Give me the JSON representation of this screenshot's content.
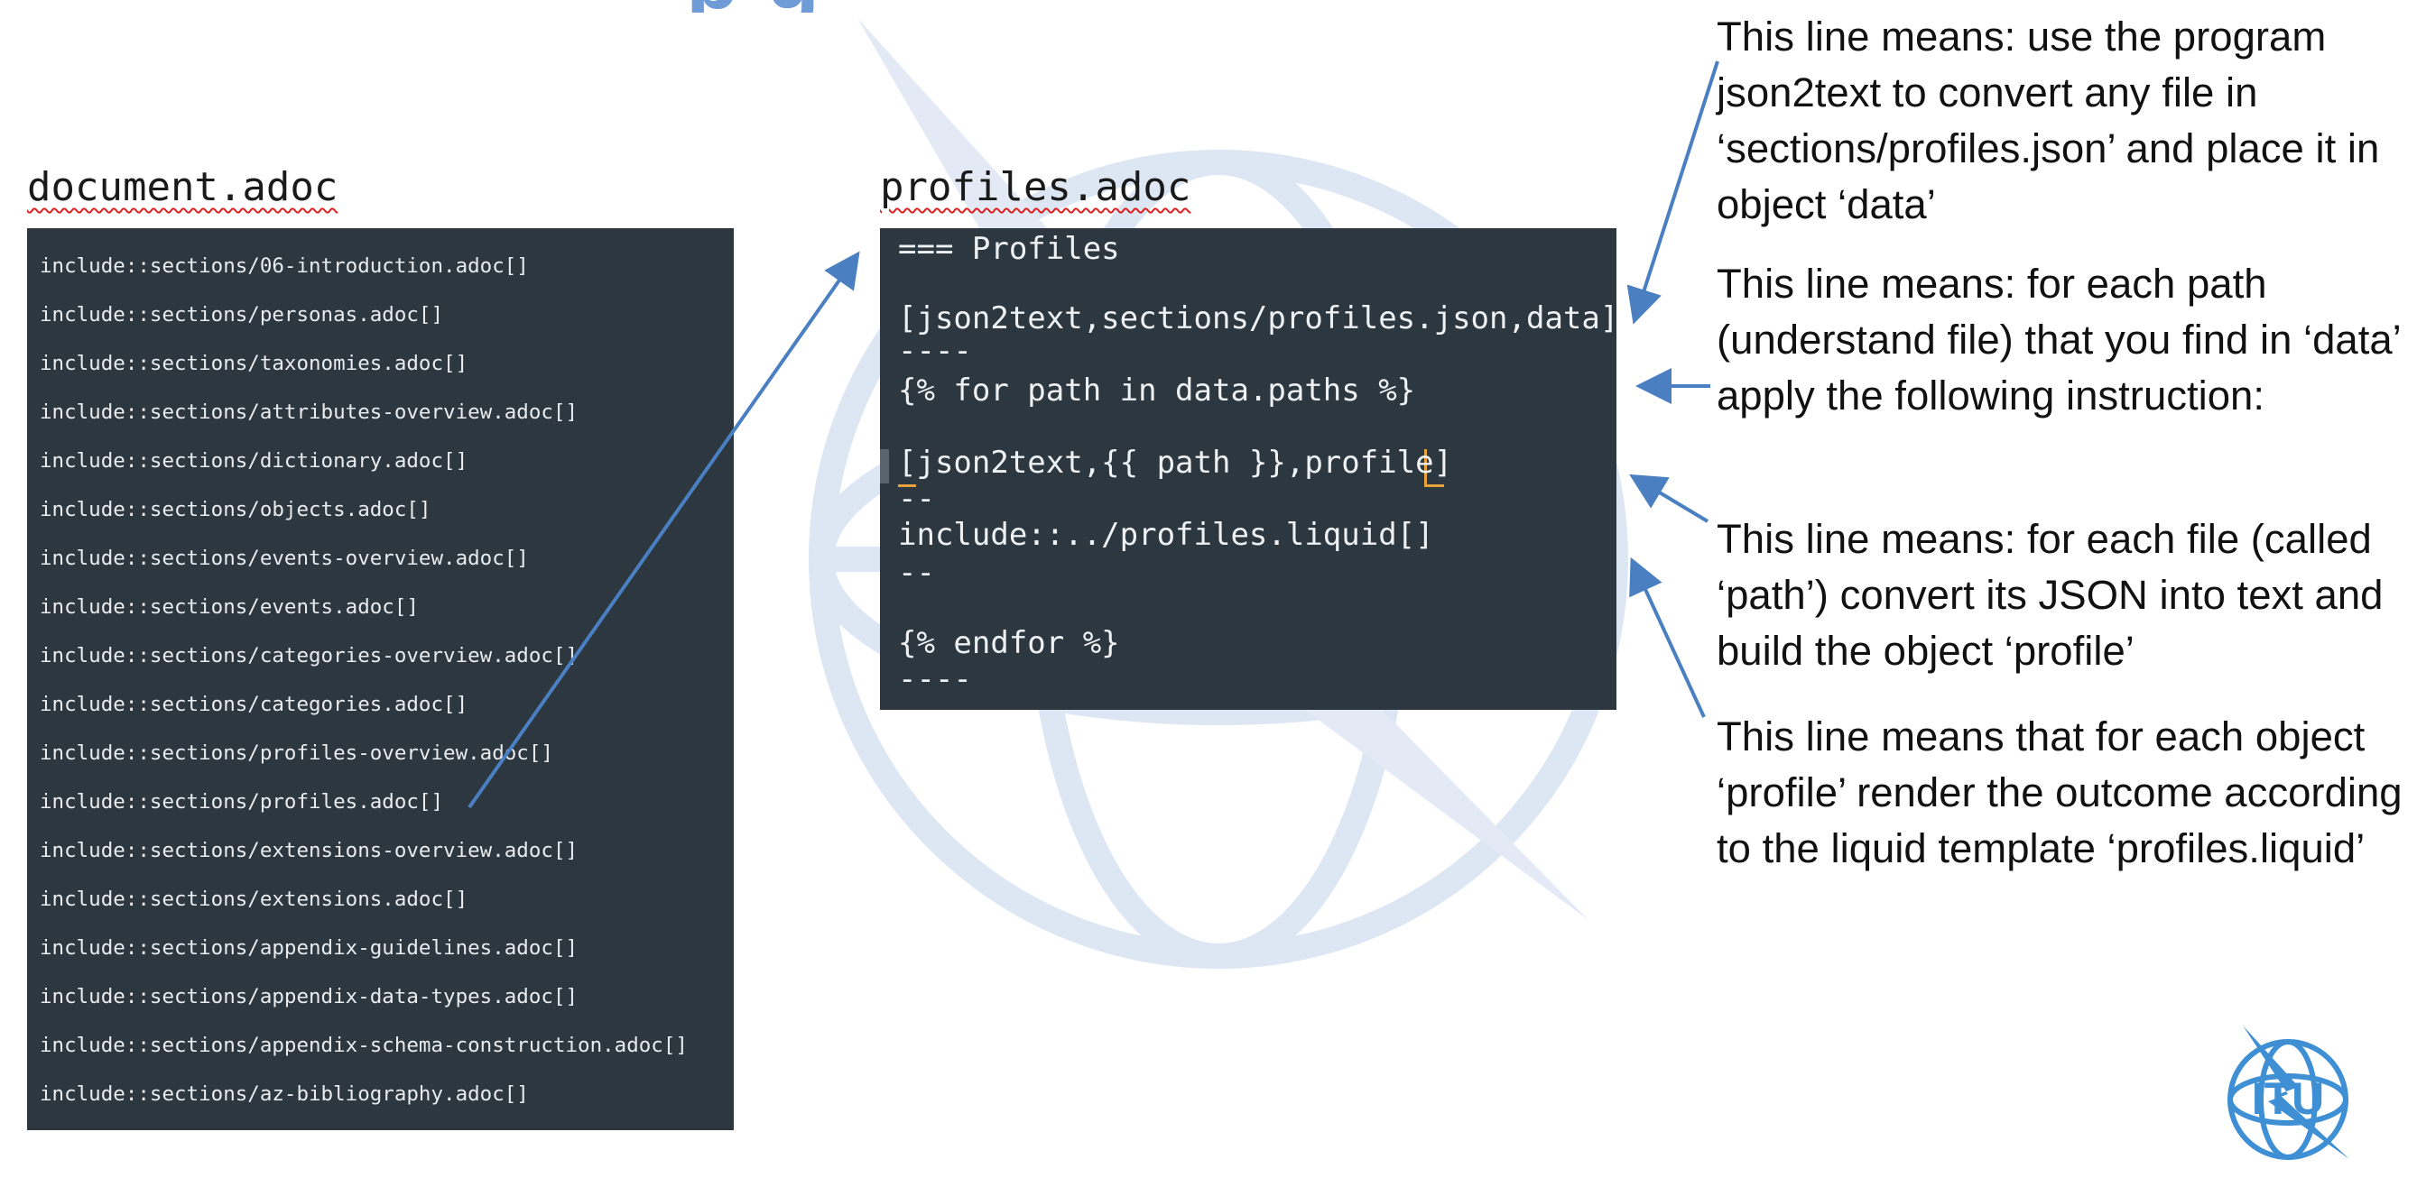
{
  "slide_title_fragment": "p g",
  "document_file": {
    "title": "document.adoc",
    "lines": [
      "include::sections/06-introduction.adoc[]",
      "include::sections/personas.adoc[]",
      "include::sections/taxonomies.adoc[]",
      "include::sections/attributes-overview.adoc[]",
      "include::sections/dictionary.adoc[]",
      "include::sections/objects.adoc[]",
      "include::sections/events-overview.adoc[]",
      "include::sections/events.adoc[]",
      "include::sections/categories-overview.adoc[]",
      "include::sections/categories.adoc[]",
      "include::sections/profiles-overview.adoc[]",
      "include::sections/profiles.adoc[]",
      "include::sections/extensions-overview.adoc[]",
      "include::sections/extensions.adoc[]",
      "include::sections/appendix-guidelines.adoc[]",
      "include::sections/appendix-data-types.adoc[]",
      "include::sections/appendix-schema-construction.adoc[]",
      "include::sections/az-bibliography.adoc[]"
    ]
  },
  "profiles_file": {
    "title": "profiles.adoc",
    "lines": [
      "=== Profiles",
      "",
      "[json2text,sections/profiles.json,data]",
      "----",
      "{% for path in data.paths %}",
      "",
      "[json2text,{{ path }},profile]",
      "--",
      "include::../profiles.liquid[]",
      "--",
      "",
      "{% endfor %}",
      "----"
    ]
  },
  "annotations": [
    "This line means: use the program json2text to convert any file in ‘sections/profiles.json’ and place it in object ‘data’",
    "This line means: for each path (understand file) that you find in ‘data’ apply the following instruction:",
    "This line means: for each file (called ‘path’) convert its JSON into text and build the object ‘profile’",
    "This line means that for each object ‘profile’ render the outcome according to the liquid template ‘profiles.liquid’"
  ],
  "logo": {
    "text": "ITU",
    "color": "#3f8fd4"
  },
  "colors": {
    "code_background": "#2d3740",
    "arrow": "#4a7fc1",
    "watermark": "#dde6f3",
    "caret": "#e8a33c"
  }
}
